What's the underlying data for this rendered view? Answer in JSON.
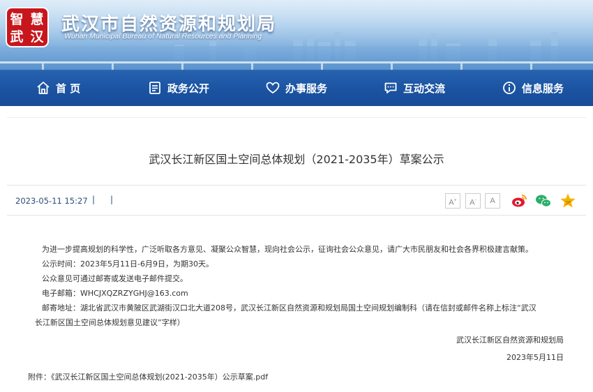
{
  "header": {
    "logo_text": [
      "智",
      "慧",
      "武",
      "汉"
    ],
    "title": "武汉市自然资源和规划局",
    "subtitle": "Wuhan Municipal Bureau of Natural Resources and Planning"
  },
  "nav": {
    "items": [
      {
        "label": "首 页",
        "icon": "home-icon"
      },
      {
        "label": "政务公开",
        "icon": "document-icon"
      },
      {
        "label": "办事服务",
        "icon": "heart-hands-icon"
      },
      {
        "label": "互动交流",
        "icon": "chat-icon"
      },
      {
        "label": "信息服务",
        "icon": "info-icon"
      }
    ]
  },
  "article": {
    "title": "武汉长江新区国土空间总体规划（2021-2035年）草案公示",
    "date": "2023-05-11 15:27",
    "sep": "|",
    "font_buttons": [
      "A",
      "A",
      "A"
    ],
    "font_button_sups": [
      "+",
      "-",
      ""
    ],
    "paragraphs": [
      "为进一步提高规划的科学性，广泛听取各方意见、凝聚公众智慧，现向社会公示，征询社会公众意见，请广大市民朋友和社会各界积极建言献策。",
      "公示时间：2023年5月11日-6月9日，为期30天。",
      "公众意见可通过邮寄或发送电子邮件提交。",
      "电子邮箱：WHCJXQZRZYGHJ@163.com",
      "邮寄地址：湖北省武汉市黄陂区武湖街汉口北大道208号，武汉长江新区自然资源和规划局国土空间规划编制科（请在信封或邮件名称上标注“武汉",
      "长江新区国土空间总体规划意见建议”字样）"
    ],
    "signature": "武汉长江新区自然资源和规划局",
    "sign_date": "2023年5月11日",
    "attachment": "附件：《武汉长江新区国土空间总体规划(2021-2035年）公示草案.pdf"
  },
  "share": {
    "icons": [
      "weibo-icon",
      "wechat-icon",
      "favorite-star-icon"
    ]
  },
  "colors": {
    "nav_bg": "#1c58aa",
    "logo_red": "#c8161d",
    "date_blue": "#2a4d7a",
    "weibo_red": "#e6162d",
    "wechat_green": "#2aae67",
    "star_yellow": "#f5b400"
  }
}
